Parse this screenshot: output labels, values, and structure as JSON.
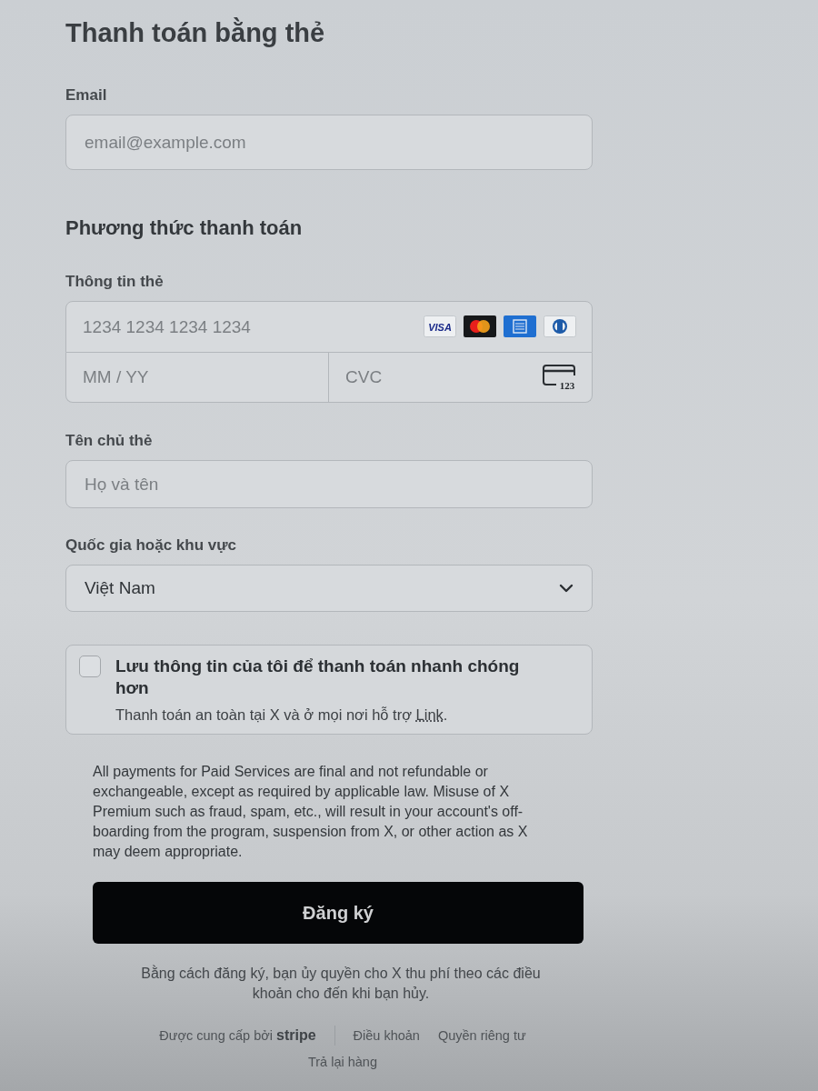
{
  "title": "Thanh toán bằng thẻ",
  "email": {
    "label": "Email",
    "placeholder": "email@example.com"
  },
  "payment_method": {
    "heading": "Phương thức thanh toán",
    "card_info": {
      "label": "Thông tin thẻ",
      "number_placeholder": "1234 1234 1234 1234",
      "brands": [
        {
          "kind": "visa",
          "text": "VISA"
        },
        {
          "kind": "mastercard"
        },
        {
          "kind": "amex"
        },
        {
          "kind": "diners"
        }
      ],
      "expiry_placeholder": "MM / YY",
      "cvc_placeholder": "CVC",
      "cvc_icon_text": "123"
    }
  },
  "cardholder": {
    "label": "Tên chủ thẻ",
    "placeholder": "Họ và tên"
  },
  "country": {
    "label": "Quốc gia hoặc khu vực",
    "value": "Việt Nam"
  },
  "save_info": {
    "checked": false,
    "title": "Lưu thông tin của tôi để thanh toán nhanh chóng hơn",
    "description": "Thanh toán an toàn tại X và ở mọi nơi hỗ trợ",
    "link": "Link",
    "description_end": "."
  },
  "legal_text": "All payments for Paid Services are final and not refundable or exchangeable, except as required by applicable law. Misuse of X Premium such as fraud, spam, etc., will result in your account's off-boarding from the program, suspension from X, or other action as X may deem appropriate.",
  "submit_button": "Đăng ký",
  "authorization_text": "Bằng cách đăng ký, bạn ủy quyền cho X thu phí theo các điều khoản cho đến khi bạn hủy.",
  "footer": {
    "powered_by": "Được cung cấp bởi **stripe**",
    "links": [
      "Điều khoản",
      "Quyền riêng tư",
      "Trả lại hàng"
    ]
  }
}
